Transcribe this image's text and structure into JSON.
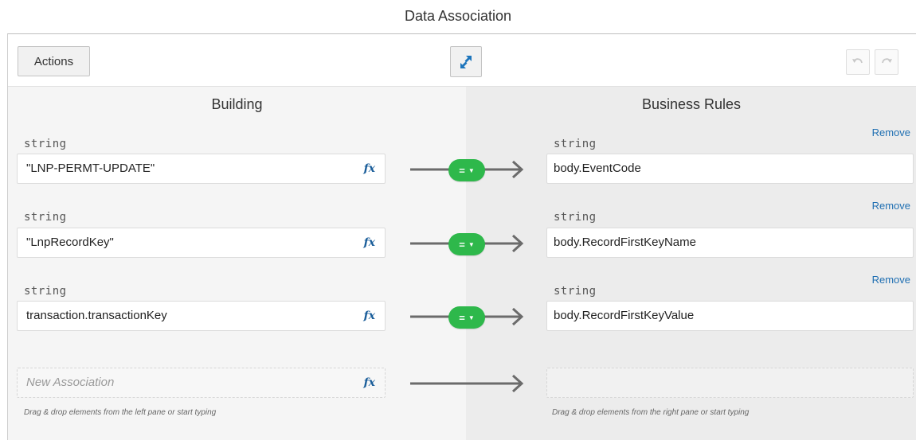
{
  "dialog": {
    "title": "Data Association"
  },
  "toolbar": {
    "actions_label": "Actions",
    "swap_icon": "swap-arrows-icon",
    "undo_icon": "undo-icon",
    "redo_icon": "redo-icon"
  },
  "left_pane": {
    "title": "Building",
    "hint": "Drag & drop elements from the left pane or start typing"
  },
  "right_pane": {
    "title": "Business Rules",
    "hint": "Drag & drop elements from the right pane or start typing"
  },
  "fx_label": "fx",
  "operator_label": "=",
  "remove_label": "Remove",
  "associations": [
    {
      "source_type": "string",
      "source": "\"LNP-PERMT-UPDATE\"",
      "target_type": "string",
      "target": "body.EventCode"
    },
    {
      "source_type": "string",
      "source": "\"LnpRecordKey\"",
      "target_type": "string",
      "target": "body.RecordFirstKeyName"
    },
    {
      "source_type": "string",
      "source": "transaction.transactionKey",
      "target_type": "string",
      "target": "body.RecordFirstKeyValue"
    }
  ],
  "new_association": {
    "placeholder": "New Association",
    "target": ""
  },
  "colors": {
    "operator": "#2eb84b",
    "link": "#1f6fb2",
    "swap_icon": "#1d75bc"
  }
}
